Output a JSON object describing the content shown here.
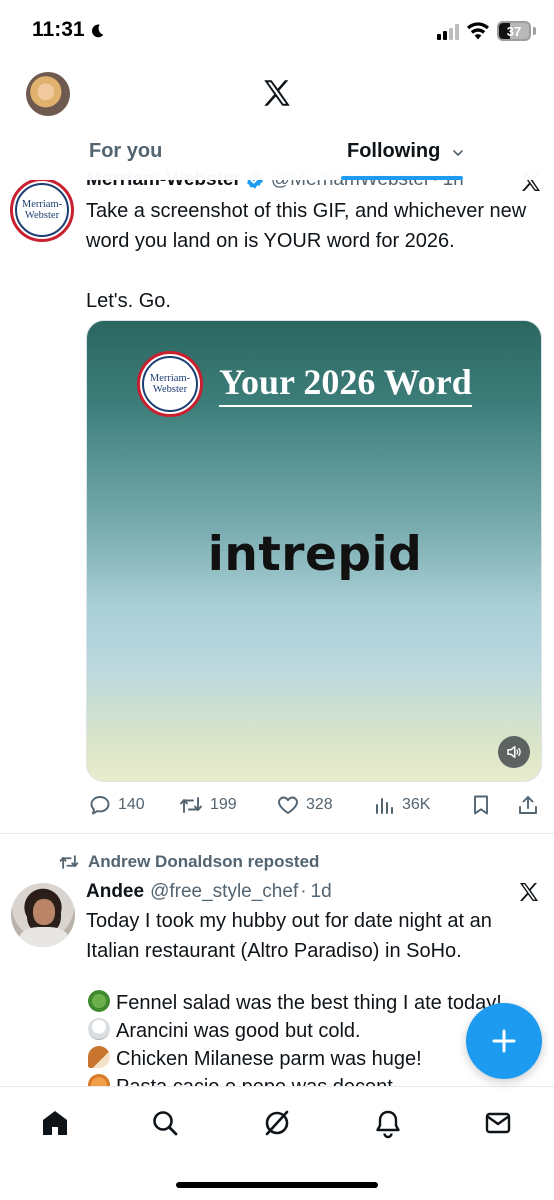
{
  "status_bar": {
    "time": "11:31",
    "battery": "37",
    "battery_level": 0.37
  },
  "header": {
    "tabs": [
      {
        "label": "For you",
        "active": false
      },
      {
        "label": "Following",
        "active": true
      }
    ],
    "logo": "x-logo-icon"
  },
  "feed": {
    "tweet1": {
      "name": "Merriam-Webster",
      "handle": "@MerriamWebster",
      "time": "1h",
      "avatar_text_1": "Merriam-",
      "avatar_text_2": "Webster",
      "text": "Take a screenshot of this GIF, and whichever new word you land on is YOUR word for 2026.\n\nLet's. Go.",
      "media": {
        "logo_text_1": "Merriam-",
        "logo_text_2": "Webster",
        "heading": "Your 2026 Word",
        "word": "intrepid"
      },
      "actions": {
        "replies": "140",
        "reposts": "199",
        "likes": "328",
        "views": "36K"
      }
    },
    "tweet2": {
      "reposted_by": "Andrew Donaldson reposted",
      "name": "Andee",
      "handle": "@free_style_chef",
      "time": "1d",
      "text": "Today I took my hubby out for date night at an Italian restaurant (Altro Paradiso) in SoHo.",
      "lines": [
        "Fennel salad was the best thing I ate today!",
        "Arancini was good but cold.",
        "Chicken Milanese parm was huge!",
        "Pasta cacio e pepe was decent."
      ]
    }
  },
  "colors": {
    "accent": "#1d9bf0",
    "text": "#0f1419",
    "muted": "#536471"
  }
}
